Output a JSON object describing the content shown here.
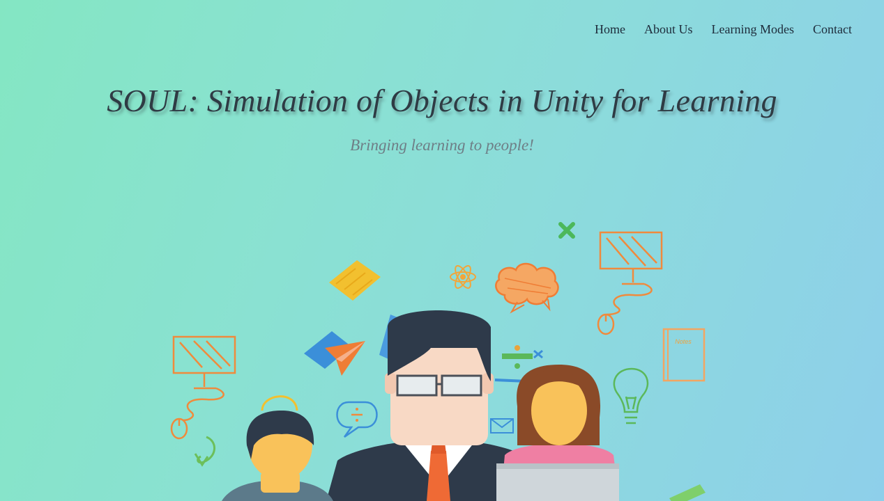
{
  "nav": {
    "items": [
      {
        "label": "Home"
      },
      {
        "label": "About Us"
      },
      {
        "label": "Learning Modes"
      },
      {
        "label": "Contact"
      }
    ]
  },
  "hero": {
    "title": "SOUL: Simulation of Objects in Unity for Learning",
    "subtitle": "Bringing learning to people!",
    "illustration": {
      "notebook_label": "Notes",
      "icons": [
        "monitor-icon",
        "mouse-icon",
        "book-icon",
        "atom-icon",
        "cloud-icon",
        "paper-plane-icon",
        "lightbulb-icon",
        "envelope-icon",
        "notebook-icon",
        "ruler-icon",
        "math-symbols-icon"
      ]
    }
  },
  "colors": {
    "background_start": "#84e6c3",
    "background_end": "#8ecfea",
    "title": "#2f3b44",
    "subtitle": "#6e7e86",
    "doodle_orange": "#f08a3c",
    "doodle_green": "#6cbf5a",
    "doodle_blue": "#3b8fd9",
    "doodle_yellow": "#f2c02f"
  }
}
